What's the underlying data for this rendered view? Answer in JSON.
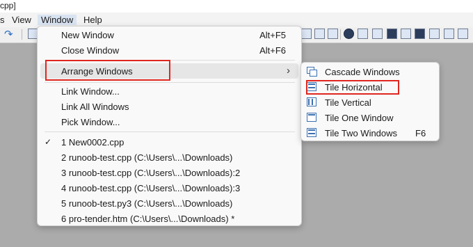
{
  "window": {
    "title_fragment": "cpp]"
  },
  "menubar": {
    "items": [
      "s",
      "View",
      "Window",
      "Help"
    ]
  },
  "window_menu": {
    "items": [
      {
        "label": "New Window",
        "shortcut": "Alt+F5"
      },
      {
        "label": "Close Window",
        "shortcut": "Alt+F6"
      },
      {
        "label": "Arrange Windows",
        "arrow": "›"
      },
      {
        "label": "Link Window..."
      },
      {
        "label": "Link All Windows"
      },
      {
        "label": "Pick Window..."
      },
      {
        "label": "1  New0002.cpp",
        "check": "✓"
      },
      {
        "label": "2  runoob-test.cpp (C:\\Users\\...\\Downloads)"
      },
      {
        "label": "3  runoob-test.cpp (C:\\Users\\...\\Downloads):2"
      },
      {
        "label": "4  runoob-test.cpp (C:\\Users\\...\\Downloads):3"
      },
      {
        "label": "5  runoob-test.py3 (C:\\Users\\...\\Downloads)"
      },
      {
        "label": "6  pro-tender.htm (C:\\Users\\...\\Downloads) *"
      }
    ]
  },
  "arrange_submenu": {
    "items": [
      {
        "label": "Cascade Windows",
        "icon": "cascade-windows-icon"
      },
      {
        "label": "Tile Horizontal",
        "icon": "tile-horizontal-icon"
      },
      {
        "label": "Tile Vertical",
        "icon": "tile-vertical-icon"
      },
      {
        "label": "Tile One Window",
        "icon": "tile-one-window-icon"
      },
      {
        "label": "Tile Two Windows",
        "icon": "tile-two-windows-icon",
        "shortcut": "F6"
      }
    ]
  },
  "colors": {
    "highlight_box": "#e0261f",
    "icon_blue": "#3a6fb0",
    "menu_bg": "#f9f9f9"
  }
}
